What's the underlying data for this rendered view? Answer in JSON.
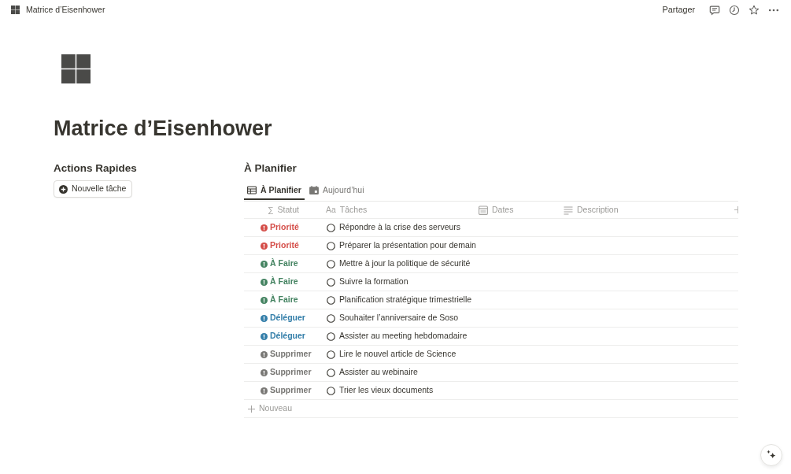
{
  "topbar": {
    "breadcrumb": "Matrice d’Eisenhower",
    "share": "Partager"
  },
  "page": {
    "title": "Matrice d’Eisenhower"
  },
  "quick_actions": {
    "heading": "Actions Rapides",
    "button": "Nouvelle tâche"
  },
  "database": {
    "title": "À Planifier",
    "tabs": [
      {
        "label": "À Planifier",
        "kind": "table",
        "selected": true
      },
      {
        "label": "Aujourd’hui",
        "kind": "calendar",
        "selected": false
      }
    ],
    "columns": [
      {
        "label": "Statut",
        "kind": "formula",
        "glyph": "∑"
      },
      {
        "label": "Tâches",
        "kind": "title",
        "glyph": "Aa"
      },
      {
        "label": "Dates",
        "kind": "date"
      },
      {
        "label": "Description",
        "kind": "text"
      }
    ],
    "rows": [
      {
        "status": "Priorité",
        "color": "#d44c47",
        "task": "Répondre à la crise des serveurs",
        "checked": false
      },
      {
        "status": "Priorité",
        "color": "#d44c47",
        "task": "Préparer la présentation pour demain",
        "checked": false
      },
      {
        "status": "À Faire",
        "color": "#448361",
        "task": "Mettre à jour la politique de sécurité",
        "checked": false
      },
      {
        "status": "À Faire",
        "color": "#448361",
        "task": "Suivre la formation",
        "checked": false
      },
      {
        "status": "À Faire",
        "color": "#448361",
        "task": "Planification stratégique trimestrielle",
        "checked": false
      },
      {
        "status": "Déléguer",
        "color": "#337ea9",
        "task": "Souhaiter l’anniversaire de Soso",
        "checked": false
      },
      {
        "status": "Déléguer",
        "color": "#337ea9",
        "task": "Assister au meeting hebdomadaire",
        "checked": false
      },
      {
        "status": "Supprimer",
        "color": "#787774",
        "task": "Lire le nouvel article de Science",
        "checked": false
      },
      {
        "status": "Supprimer",
        "color": "#787774",
        "task": "Assister au webinaire",
        "checked": false
      },
      {
        "status": "Supprimer",
        "color": "#787774",
        "task": "Trier les vieux documents",
        "checked": false
      }
    ],
    "new_row": "Nouveau"
  }
}
